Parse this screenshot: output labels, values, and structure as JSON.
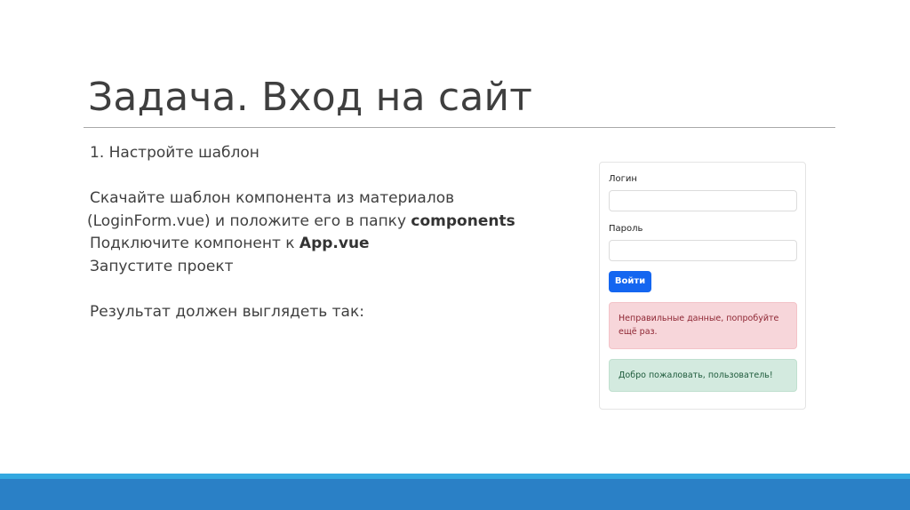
{
  "slide": {
    "title": "Задача. Вход на сайт",
    "lines": {
      "step": "1. Настройте шаблон",
      "download": "Скачайте шаблон компонента из материалов",
      "place_prefix": "(LoginForm.vue) и положите его в папку ",
      "place_bold": "components",
      "connect_prefix": "Подключите компонент к ",
      "connect_bold": "App.vue",
      "run": "Запустите проект",
      "result": "Результат должен выглядеть так:"
    }
  },
  "login_form": {
    "login_label": "Логин",
    "password_label": "Пароль",
    "login_value": "",
    "password_value": "",
    "submit_label": "Войти",
    "error_message": "Неправильные данные, попробуйте ещё раз.",
    "success_message": "Добро пожаловать, пользователь!"
  },
  "colors": {
    "button": "#1466f0",
    "error_bg": "#f7d6da",
    "success_bg": "#d3eadf",
    "bar_dark": "#2a80c6",
    "bar_light": "#33a8e0"
  }
}
